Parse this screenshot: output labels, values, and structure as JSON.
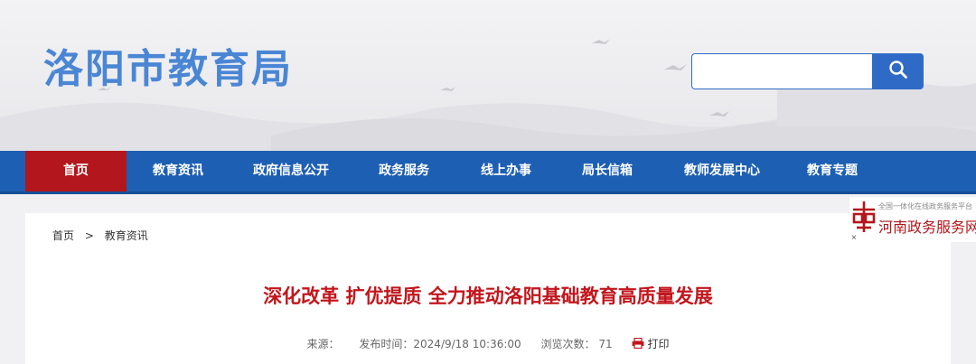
{
  "header": {
    "site_title": "洛阳市教育局",
    "search": {
      "placeholder": "",
      "value": ""
    }
  },
  "nav": {
    "items": [
      {
        "label": "首页",
        "active": true
      },
      {
        "label": "教育资讯"
      },
      {
        "label": "政府信息公开"
      },
      {
        "label": "政务服务"
      },
      {
        "label": "线上办事"
      },
      {
        "label": "局长信箱"
      },
      {
        "label": "教师发展中心"
      },
      {
        "label": "教育专题"
      }
    ]
  },
  "breadcrumb": {
    "home": "首页",
    "separator": ">",
    "current": "教育资讯"
  },
  "article": {
    "title": "深化改革 扩优提质 全力推动洛阳基础教育高质量发展",
    "meta": {
      "source_label": "来源：",
      "publish_label": "发布时间：",
      "publish_time": "2024/9/18 10:36:00",
      "views_label": "浏览次数：",
      "views": "71",
      "print_label": "打印"
    }
  },
  "badge": {
    "tagline": "全国一体化在线政务服务平台",
    "name": "河南政务服务网",
    "close": "×"
  },
  "colors": {
    "primary_blue": "#1d5fb3",
    "active_red": "#b3161c",
    "title_red": "#c2161c",
    "site_title_blue": "#4a86d4"
  }
}
